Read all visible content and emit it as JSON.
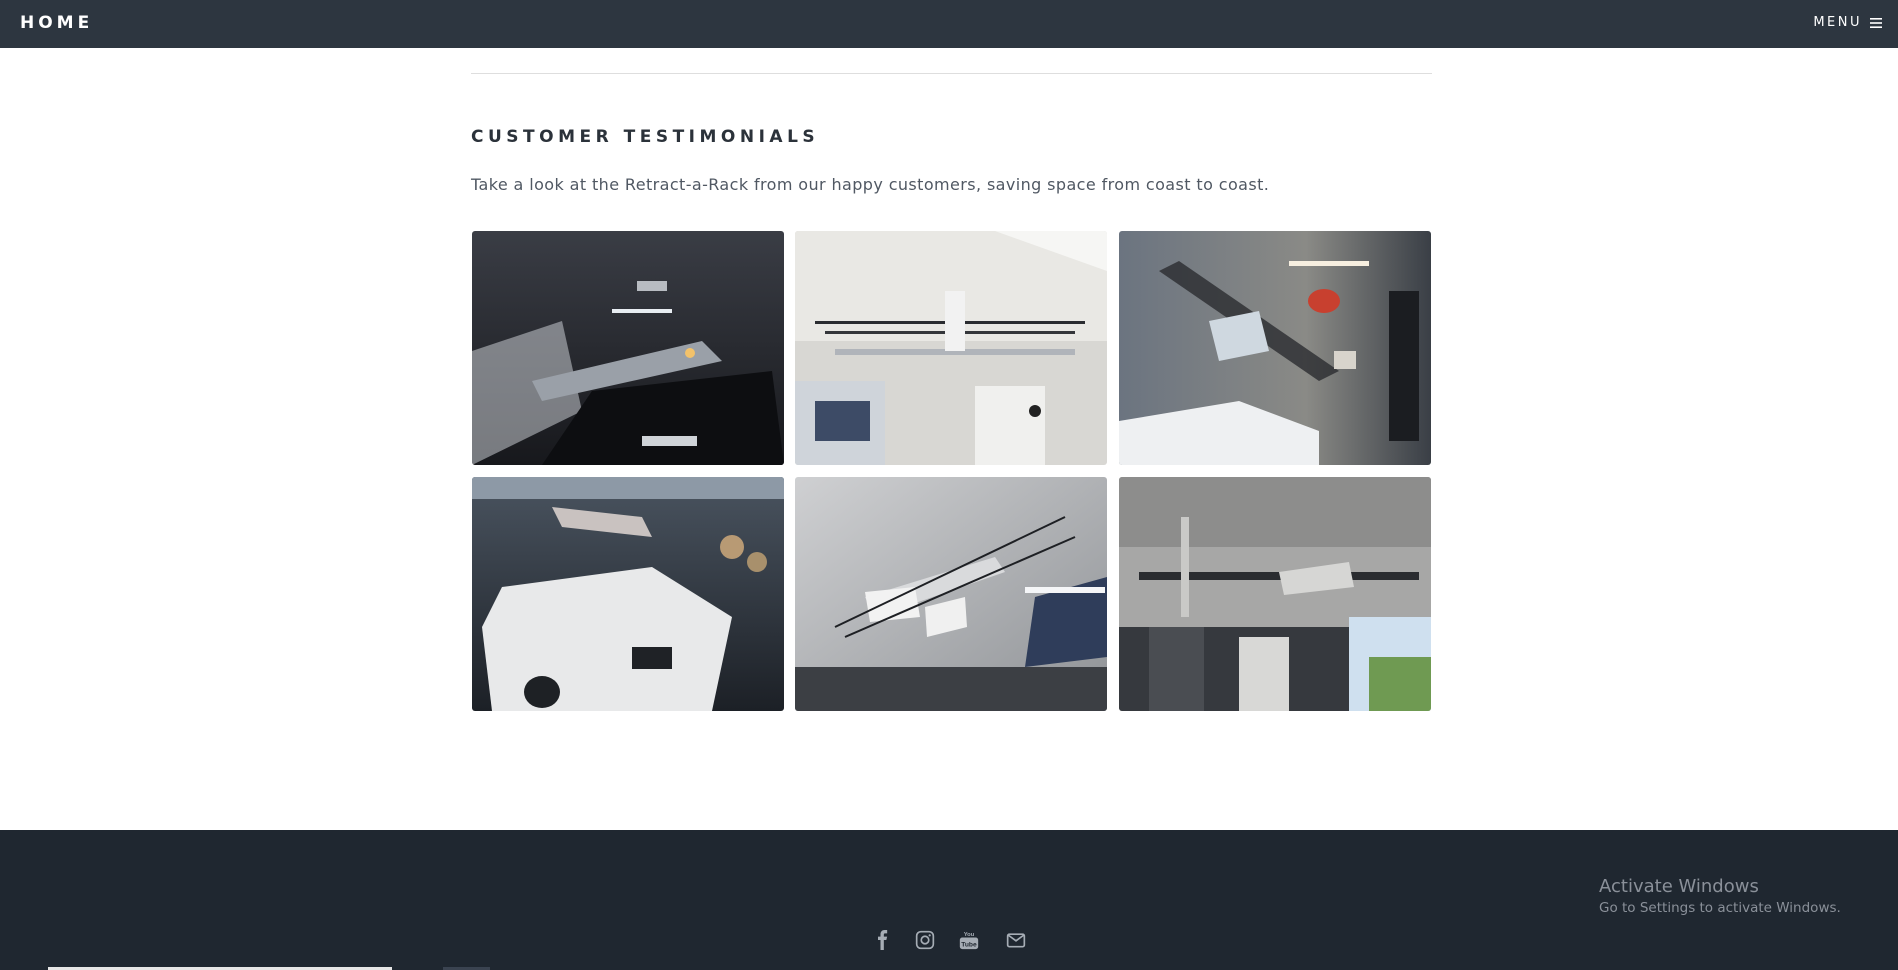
{
  "nav": {
    "brand": "HOME",
    "menu_label": "MENU",
    "menu_icon": "hamburger-icon"
  },
  "section": {
    "title": "CUSTOMER TESTIMONIALS",
    "description": "Take a look at the Retract-a-Rack from our happy customers, saving space from coast to coast."
  },
  "gallery": {
    "photos": [
      {
        "subject": "garage-ceiling-rack-over-dark-suv"
      },
      {
        "subject": "ceiling-rack-with-rods-white-ceiling"
      },
      {
        "subject": "ceiling-rack-over-white-car"
      },
      {
        "subject": "ceiling-rack-over-white-sedan"
      },
      {
        "subject": "ceiling-rack-lowered-grey-ceiling"
      },
      {
        "subject": "ceiling-rack-over-garage-cabinets"
      }
    ]
  },
  "footer": {
    "social": [
      "facebook-icon",
      "instagram-icon",
      "youtube-icon",
      "mail-icon"
    ]
  },
  "watermark": {
    "title": "Activate Windows",
    "subtitle": "Go to Settings to activate Windows."
  },
  "colors": {
    "header_bg": "#2d3640",
    "footer_bg": "#1f2730",
    "heading": "#2b323a"
  }
}
